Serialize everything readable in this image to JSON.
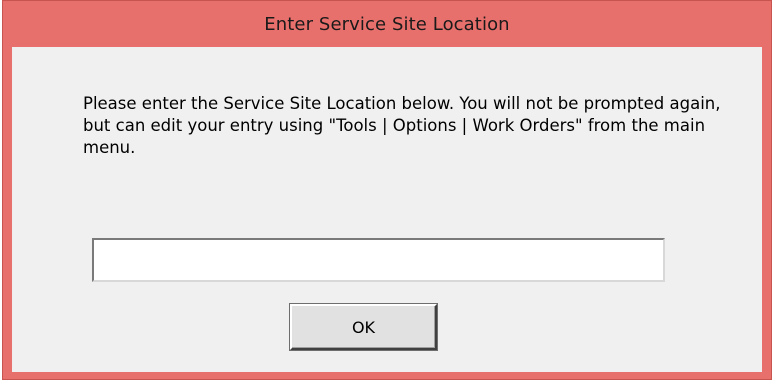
{
  "dialog": {
    "title": "Enter Service Site Location",
    "message": "Please enter the Service Site Location below. You will not be prompted again, but can edit your entry using \"Tools | Options | Work Orders\" from the main menu.",
    "input_value": "",
    "ok_label": "OK"
  },
  "colors": {
    "titlebar": "#e8706c",
    "client_background": "#f0f0f0"
  }
}
